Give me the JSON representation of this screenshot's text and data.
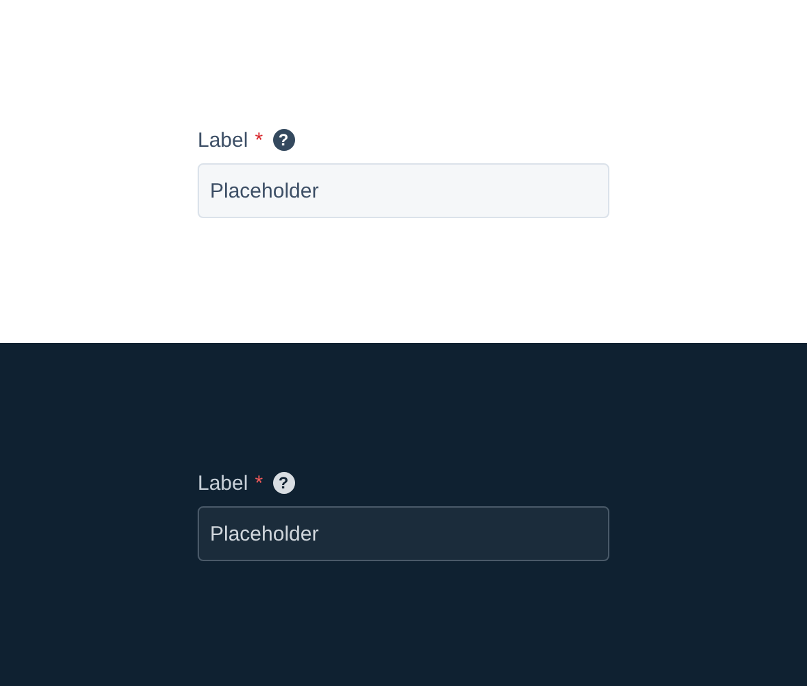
{
  "panels": [
    {
      "kind": "light",
      "label": "Label",
      "required_mark": "*",
      "help": "?",
      "placeholder": "Placeholder"
    },
    {
      "kind": "dark",
      "label": "Label",
      "required_mark": "*",
      "help": "?",
      "placeholder": "Placeholder"
    }
  ]
}
